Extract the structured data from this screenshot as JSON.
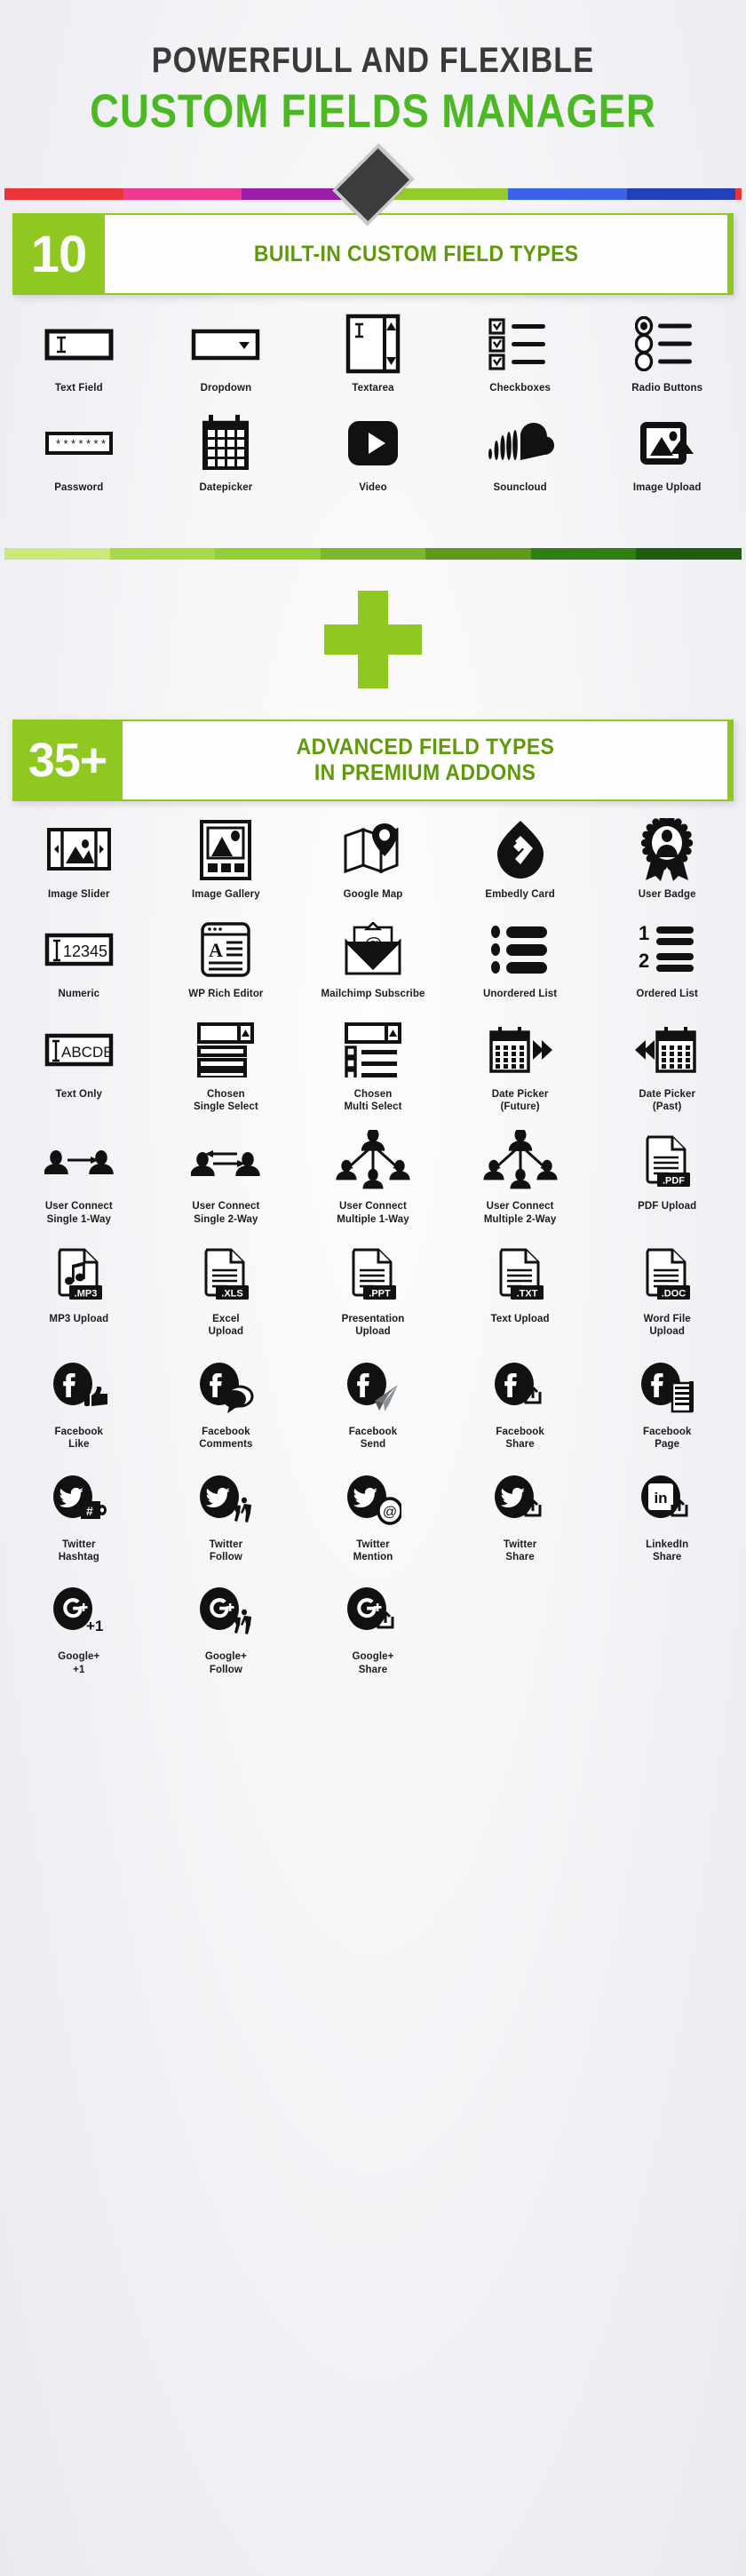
{
  "header": {
    "line1": "POWERFULL AND FLEXIBLE",
    "line2": "CUSTOM FIELDS MANAGER",
    "accent_green": "#4cb823",
    "dark_text": "#3a3a3a",
    "colorbar_segments": [
      "#ec3338",
      "#ed3a8e",
      "#9c1cab",
      "#e8e63a",
      "#93cb2a",
      "#3a63e8",
      "#2340bb",
      "#ec3338"
    ]
  },
  "section_builtin": {
    "number": "10",
    "title_line1": "BUILT-IN CUSTOM FIELD TYPES",
    "accent": "#8ec820",
    "title_color": "#5f9a0a",
    "items": [
      {
        "label": "Text Field",
        "icon": "text-field-icon"
      },
      {
        "label": "Dropdown",
        "icon": "dropdown-icon"
      },
      {
        "label": "Textarea",
        "icon": "textarea-icon"
      },
      {
        "label": "Checkboxes",
        "icon": "checkboxes-icon"
      },
      {
        "label": "Radio Buttons",
        "icon": "radio-buttons-icon"
      },
      {
        "label": "Password",
        "icon": "password-icon"
      },
      {
        "label": "Datepicker",
        "icon": "datepicker-icon"
      },
      {
        "label": "Video",
        "icon": "video-play-icon"
      },
      {
        "label": "Souncloud",
        "icon": "soundcloud-icon"
      },
      {
        "label": "Image Upload",
        "icon": "image-upload-icon"
      }
    ]
  },
  "divider": {
    "greenbar_segments": [
      "#cbe97a",
      "#a8d84c",
      "#93cf33",
      "#7fb62a",
      "#5f9a1e",
      "#2f8013",
      "#1f5e0c"
    ],
    "plus_symbol": "+",
    "plus_color": "#8ec820"
  },
  "section_premium": {
    "number": "35+",
    "title_line1": "ADVANCED FIELD TYPES",
    "title_line2": "IN PREMIUM ADDONS",
    "accent": "#8ec820",
    "title_color": "#5f9a0a",
    "items": [
      {
        "label": "Image Slider",
        "icon": "image-slider-icon"
      },
      {
        "label": "Image Gallery",
        "icon": "image-gallery-icon"
      },
      {
        "label": "Google Map",
        "icon": "google-map-icon"
      },
      {
        "label": "Embedly Card",
        "icon": "embedly-card-icon"
      },
      {
        "label": "User Badge",
        "icon": "user-badge-icon"
      },
      {
        "label": "Numeric",
        "icon": "numeric-icon",
        "icon_text": "12345"
      },
      {
        "label": "WP Rich Editor",
        "icon": "wp-rich-editor-icon"
      },
      {
        "label": "Mailchimp Subscribe",
        "icon": "mailchimp-subscribe-icon"
      },
      {
        "label": "Unordered List",
        "icon": "unordered-list-icon"
      },
      {
        "label": "Ordered List",
        "icon": "ordered-list-icon"
      },
      {
        "label": "Text Only",
        "icon": "text-only-icon",
        "icon_text": "ABCDE"
      },
      {
        "label": "Chosen\nSingle Select",
        "icon": "chosen-single-select-icon"
      },
      {
        "label": "Chosen\nMulti Select",
        "icon": "chosen-multi-select-icon"
      },
      {
        "label": "Date Picker\n(Future)",
        "icon": "date-picker-future-icon"
      },
      {
        "label": "Date Picker\n(Past)",
        "icon": "date-picker-past-icon"
      },
      {
        "label": "User Connect\nSingle 1-Way",
        "icon": "user-connect-single-1way-icon"
      },
      {
        "label": "User Connect\nSingle 2-Way",
        "icon": "user-connect-single-2way-icon"
      },
      {
        "label": "User Connect\nMultiple 1-Way",
        "icon": "user-connect-multiple-1way-icon"
      },
      {
        "label": "User Connect\nMultiple 2-Way",
        "icon": "user-connect-multiple-2way-icon"
      },
      {
        "label": "PDF Upload",
        "icon": "pdf-upload-icon",
        "icon_text": ".PDF"
      },
      {
        "label": "MP3 Upload",
        "icon": "mp3-upload-icon",
        "icon_text": ".MP3"
      },
      {
        "label": "Excel\nUpload",
        "icon": "excel-upload-icon",
        "icon_text": ".XLS"
      },
      {
        "label": "Presentation\nUpload",
        "icon": "presentation-upload-icon",
        "icon_text": ".PPT"
      },
      {
        "label": "Text Upload",
        "icon": "text-upload-icon",
        "icon_text": ".TXT"
      },
      {
        "label": "Word File\nUpload",
        "icon": "word-file-upload-icon",
        "icon_text": ".DOC"
      },
      {
        "label": "Facebook\nLike",
        "icon": "facebook-like-icon"
      },
      {
        "label": "Facebook\nComments",
        "icon": "facebook-comments-icon"
      },
      {
        "label": "Facebook\nSend",
        "icon": "facebook-send-icon"
      },
      {
        "label": "Facebook\nShare",
        "icon": "facebook-share-icon"
      },
      {
        "label": "Facebook\nPage",
        "icon": "facebook-page-icon"
      },
      {
        "label": "Twitter\nHashtag",
        "icon": "twitter-hashtag-icon"
      },
      {
        "label": "Twitter\nFollow",
        "icon": "twitter-follow-icon"
      },
      {
        "label": "Twitter\nMention",
        "icon": "twitter-mention-icon"
      },
      {
        "label": "Twitter\nShare",
        "icon": "twitter-share-icon"
      },
      {
        "label": "LinkedIn\nShare",
        "icon": "linkedin-share-icon"
      },
      {
        "label": "Google+\n+1",
        "icon": "googleplus-plusone-icon",
        "icon_text": "+1"
      },
      {
        "label": "Google+\nFollow",
        "icon": "googleplus-follow-icon"
      },
      {
        "label": "Google+\nShare",
        "icon": "googleplus-share-icon"
      }
    ]
  }
}
